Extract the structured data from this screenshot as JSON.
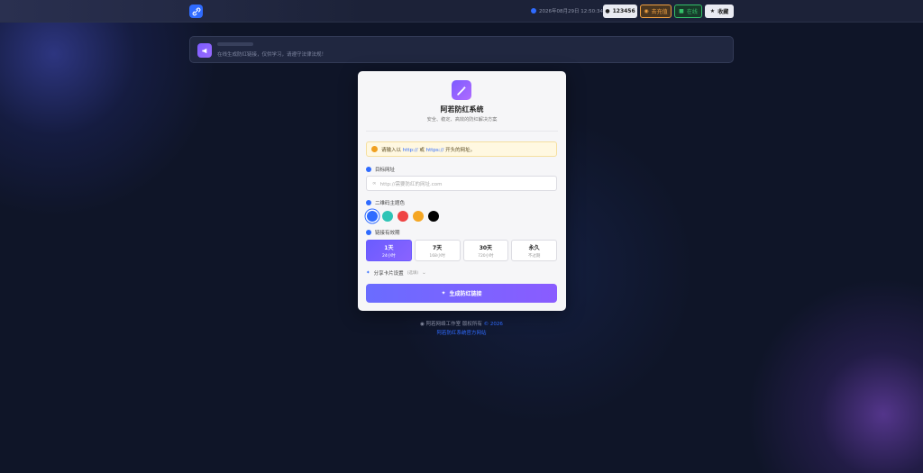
{
  "topbar": {
    "datetime": "2026年08月29日 12:50:34",
    "user_label": "123456",
    "recharge_label": "去充值",
    "online_label": "在线",
    "favorite_label": "收藏"
  },
  "notice": {
    "text": "在线生成防红链接，仅供学习，请遵守法律法规！"
  },
  "card": {
    "title": "阿若防红系统",
    "subtitle": "安全、稳定、高效的防红解决方案",
    "warning": {
      "prefix": "请输入以 ",
      "http": "http://",
      "or": " 或 ",
      "https": "https://",
      "suffix": " 开头的网址。"
    },
    "target_url_label": "目标网址",
    "target_url_placeholder": "http://需要防红的网址.com",
    "qr_color_label": "二维码主题色",
    "colors": [
      "#2f6bff",
      "#2ec4b6",
      "#ef4444",
      "#f5a623",
      "#000000"
    ],
    "validity_label": "链接有效期",
    "validity_options": [
      {
        "title": "1天",
        "sub": "24小时"
      },
      {
        "title": "7天",
        "sub": "168小时"
      },
      {
        "title": "30天",
        "sub": "720小时"
      },
      {
        "title": "永久",
        "sub": "不过期"
      }
    ],
    "share_label": "分享卡片设置",
    "share_optional": "(选填)",
    "generate_label": "生成防红链接"
  },
  "footer": {
    "copyright": "阿若网络工作室 版权所有 ",
    "year": "© 2026",
    "site_link": "阿若防红系统官方网站"
  }
}
